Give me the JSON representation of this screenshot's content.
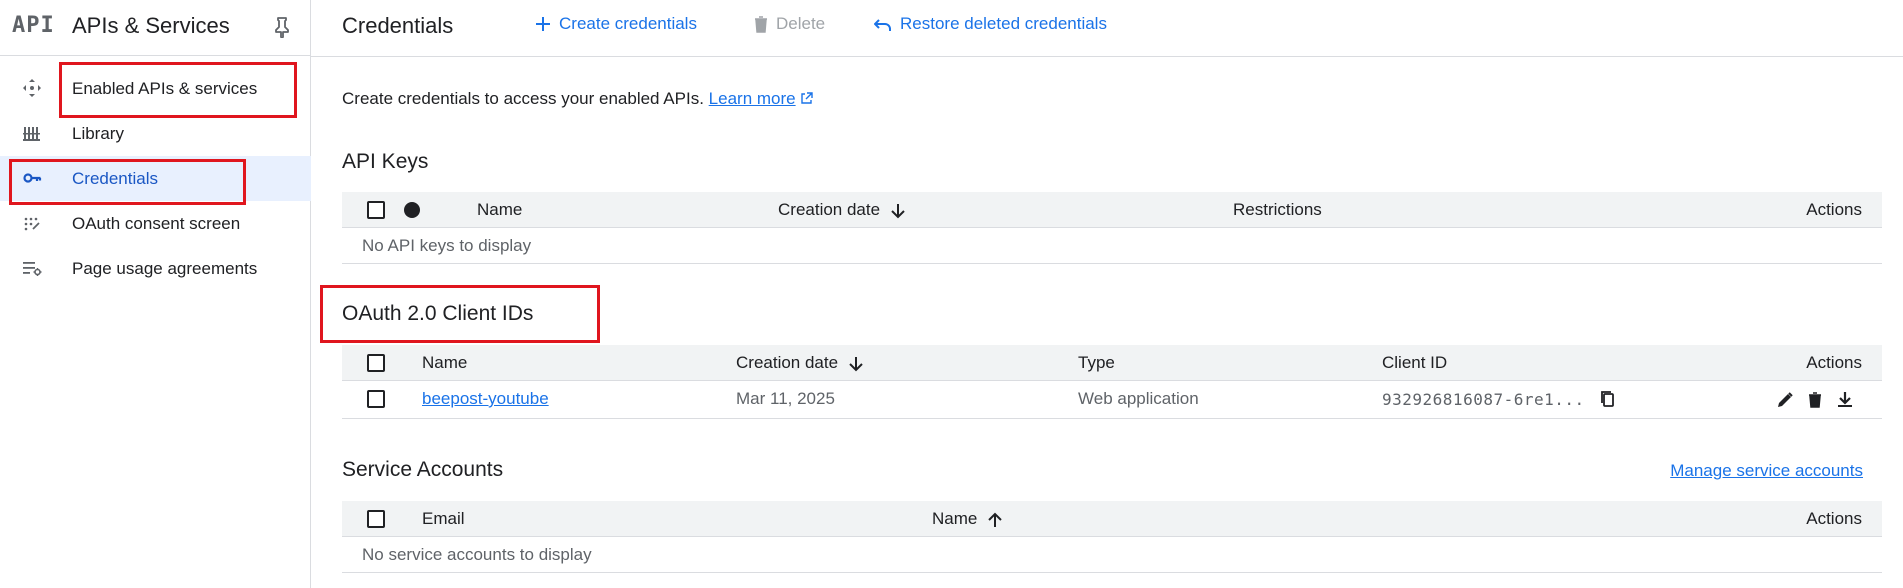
{
  "sidebar": {
    "logo": "API",
    "title": "APIs & Services",
    "items": [
      {
        "label": "Enabled APIs & services",
        "icon": "enabled-apis-icon"
      },
      {
        "label": "Library",
        "icon": "library-icon"
      },
      {
        "label": "Credentials",
        "icon": "key-icon",
        "active": true
      },
      {
        "label": "OAuth consent screen",
        "icon": "oauth-consent-icon"
      },
      {
        "label": "Page usage agreements",
        "icon": "page-usage-icon"
      }
    ]
  },
  "toolbar": {
    "title": "Credentials",
    "create_label": "Create credentials",
    "delete_label": "Delete",
    "restore_label": "Restore deleted credentials"
  },
  "intro": {
    "text": "Create credentials to access your enabled APIs.",
    "learn_more": "Learn more"
  },
  "api_keys": {
    "title": "API Keys",
    "columns": {
      "name": "Name",
      "creation_date": "Creation date",
      "restrictions": "Restrictions",
      "actions": "Actions"
    },
    "empty": "No API keys to display"
  },
  "oauth": {
    "title": "OAuth 2.0 Client IDs",
    "columns": {
      "name": "Name",
      "creation_date": "Creation date",
      "type": "Type",
      "client_id": "Client ID",
      "actions": "Actions"
    },
    "rows": [
      {
        "name": "beepost-youtube",
        "creation_date": "Mar 11, 2025",
        "type": "Web application",
        "client_id": "932926816087-6re1..."
      }
    ]
  },
  "service_accounts": {
    "title": "Service Accounts",
    "manage_link": "Manage service accounts",
    "columns": {
      "email": "Email",
      "name": "Name",
      "actions": "Actions"
    },
    "empty": "No service accounts to display"
  },
  "colors": {
    "accent": "#1a73e8",
    "highlight": "#e0161e",
    "active_bg": "#e8f0fe"
  }
}
